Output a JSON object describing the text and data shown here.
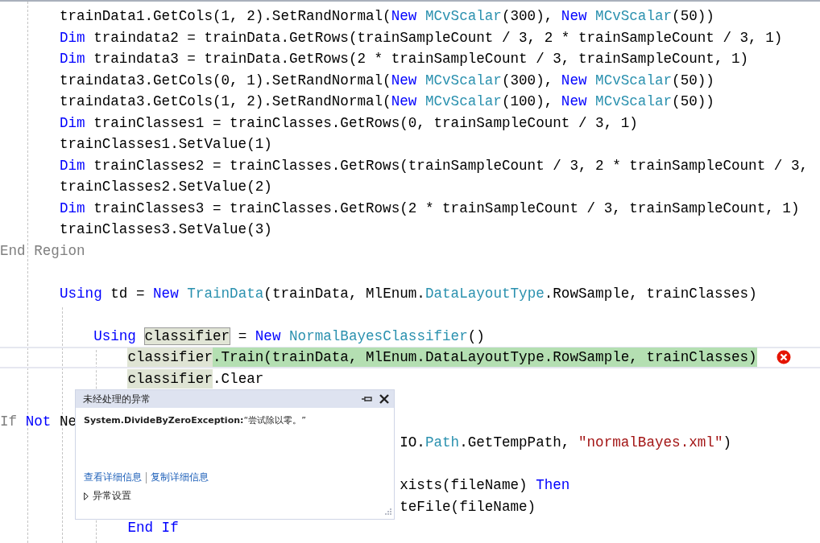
{
  "editor": {
    "lines": [
      {
        "kind": "code",
        "tokens": [
          {
            "text": "       trainData1.GetCols(1, 2).SetRandNormal(",
            "kind": "plain"
          },
          {
            "text": "New ",
            "kind": "keyword"
          },
          {
            "text": "MCvScalar",
            "kind": "type"
          },
          {
            "text": "(300), ",
            "kind": "plain"
          },
          {
            "text": "New ",
            "kind": "keyword"
          },
          {
            "text": "MCvScalar",
            "kind": "type"
          },
          {
            "text": "(50))",
            "kind": "plain"
          }
        ]
      },
      {
        "kind": "code",
        "tokens": [
          {
            "text": "       Dim",
            "kind": "keyword"
          },
          {
            "text": " traindata2 = trainData.GetRows(trainSampleCount / 3, 2 * trainSampleCount / 3, 1)",
            "kind": "plain"
          }
        ]
      },
      {
        "kind": "code",
        "tokens": [
          {
            "text": "       Dim",
            "kind": "keyword"
          },
          {
            "text": " traindata3 = trainData.GetRows(2 * trainSampleCount / 3, trainSampleCount, 1)",
            "kind": "plain"
          }
        ]
      },
      {
        "kind": "code",
        "tokens": [
          {
            "text": "       traindata3.GetCols(0, 1).SetRandNormal(",
            "kind": "plain"
          },
          {
            "text": "New ",
            "kind": "keyword"
          },
          {
            "text": "MCvScalar",
            "kind": "type"
          },
          {
            "text": "(300), ",
            "kind": "plain"
          },
          {
            "text": "New ",
            "kind": "keyword"
          },
          {
            "text": "MCvScalar",
            "kind": "type"
          },
          {
            "text": "(50))",
            "kind": "plain"
          }
        ]
      },
      {
        "kind": "code",
        "tokens": [
          {
            "text": "       traindata3.GetCols(1, 2).SetRandNormal(",
            "kind": "plain"
          },
          {
            "text": "New ",
            "kind": "keyword"
          },
          {
            "text": "MCvScalar",
            "kind": "type"
          },
          {
            "text": "(100), ",
            "kind": "plain"
          },
          {
            "text": "New ",
            "kind": "keyword"
          },
          {
            "text": "MCvScalar",
            "kind": "type"
          },
          {
            "text": "(50))",
            "kind": "plain"
          }
        ]
      },
      {
        "kind": "code",
        "tokens": [
          {
            "text": "       Dim",
            "kind": "keyword"
          },
          {
            "text": " trainClasses1 = trainClasses.GetRows(0, trainSampleCount / 3, 1)",
            "kind": "plain"
          }
        ]
      },
      {
        "kind": "code",
        "tokens": [
          {
            "text": "       trainClasses1.SetValue(1)",
            "kind": "plain"
          }
        ]
      },
      {
        "kind": "code",
        "tokens": [
          {
            "text": "       Dim",
            "kind": "keyword"
          },
          {
            "text": " trainClasses2 = trainClasses.GetRows(trainSampleCount / 3, 2 * trainSampleCount / 3,",
            "kind": "plain"
          }
        ]
      },
      {
        "kind": "code",
        "tokens": [
          {
            "text": "       trainClasses2.SetValue(2)",
            "kind": "plain"
          }
        ]
      },
      {
        "kind": "code",
        "tokens": [
          {
            "text": "       Dim",
            "kind": "keyword"
          },
          {
            "text": " trainClasses3 = trainClasses.GetRows(2 * trainSampleCount / 3, trainSampleCount, 1)",
            "kind": "plain"
          }
        ]
      },
      {
        "kind": "code",
        "tokens": [
          {
            "text": "       trainClasses3.SetValue(3)",
            "kind": "plain"
          }
        ]
      },
      {
        "kind": "code",
        "tokens": [
          {
            "text": "End Region",
            "kind": "dim"
          }
        ]
      },
      {
        "kind": "blank"
      },
      {
        "kind": "code",
        "tokens": [
          {
            "text": "       Using",
            "kind": "keyword"
          },
          {
            "text": " td = ",
            "kind": "plain"
          },
          {
            "text": "New ",
            "kind": "keyword"
          },
          {
            "text": "TrainData",
            "kind": "type"
          },
          {
            "text": "(trainData, MlEnum.",
            "kind": "plain"
          },
          {
            "text": "DataLayoutType",
            "kind": "type"
          },
          {
            "text": ".RowSample, trainClasses)",
            "kind": "plain"
          }
        ]
      },
      {
        "kind": "blank"
      },
      {
        "kind": "code",
        "tokens": [
          {
            "text": "           Using ",
            "kind": "keyword"
          },
          {
            "text": "classifier",
            "kind": "plain",
            "boxed": true
          },
          {
            "text": " = ",
            "kind": "plain"
          },
          {
            "text": "New ",
            "kind": "keyword"
          },
          {
            "text": "NormalBayesClassifier",
            "kind": "type"
          },
          {
            "text": "()",
            "kind": "plain"
          }
        ]
      },
      {
        "kind": "code",
        "current": true,
        "error": true,
        "tokens": [
          {
            "text": "               classifier",
            "kind": "plain",
            "reference": true
          },
          {
            "text": ".Train(trainData, MlEnum.DataLayoutType.RowSample, trainClasses)",
            "kind": "plain",
            "statement": true
          }
        ]
      },
      {
        "kind": "code",
        "tokens": [
          {
            "text": "               classifier",
            "kind": "plain",
            "reference": true
          },
          {
            "text": ".Clear",
            "kind": "plain"
          }
        ]
      },
      {
        "kind": "blank"
      },
      {
        "kind": "code",
        "tokens": [
          {
            "text": "If ",
            "kind": "dim"
          },
          {
            "text": "Not",
            "kind": "keyword"
          },
          {
            "text": " Ne",
            "kind": "plain"
          }
        ]
      },
      {
        "kind": "code",
        "tokens": [
          {
            "text": "                                               IO.",
            "kind": "plain"
          },
          {
            "text": "Path",
            "kind": "type"
          },
          {
            "text": ".GetTempPath, ",
            "kind": "plain"
          },
          {
            "text": "\"normalBayes.xml\"",
            "kind": "string"
          },
          {
            "text": ")",
            "kind": "plain"
          }
        ]
      },
      {
        "kind": "blank"
      },
      {
        "kind": "code",
        "tokens": [
          {
            "text": "                                               xists(fileName) ",
            "kind": "plain"
          },
          {
            "text": "Then",
            "kind": "keyword"
          }
        ]
      },
      {
        "kind": "code",
        "tokens": [
          {
            "text": "                                               teFile(fileName)",
            "kind": "plain"
          }
        ]
      },
      {
        "kind": "code",
        "tokens": [
          {
            "text": "               End If",
            "kind": "keyword"
          }
        ]
      }
    ]
  },
  "exception_popup": {
    "title": "未经处理的异常",
    "message": "**System.DivideByZeroException:**“尝试除以零。”",
    "links": [
      "查看详细信息",
      "复制详细信息"
    ],
    "settings": {
      "label": "异常设置",
      "expanded": false
    }
  }
}
